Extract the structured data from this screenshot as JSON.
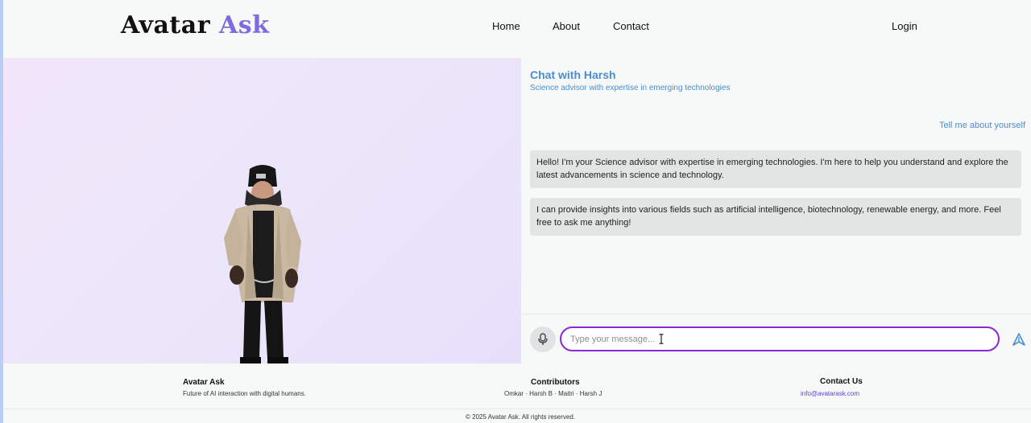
{
  "header": {
    "brand_main": "Avatar",
    "brand_accent": "Ask",
    "nav": [
      "Home",
      "About",
      "Contact"
    ],
    "login": "Login"
  },
  "chat": {
    "title": "Chat with Harsh",
    "subtitle": "Science advisor with expertise in emerging technologies",
    "user_message": "Tell me about yourself",
    "bot_messages": [
      "Hello! I'm your Science advisor with expertise in emerging technologies. I'm here to help you understand and explore the latest advancements in science and technology.",
      "I can provide insights into various fields such as artificial intelligence, biotechnology, renewable energy, and more. Feel free to ask me anything!"
    ],
    "input_placeholder": "Type your message...",
    "input_value": ""
  },
  "footer": {
    "brand_title": "Avatar Ask",
    "brand_tagline": "Future of AI interaction with digital humans.",
    "contributors_title": "Contributors",
    "contributors_list": "Omkar · Harsh B · Maitri · Harsh J",
    "contact_title": "Contact Us",
    "contact_email": "info@avatarask.com",
    "copyright": "© 2025 Avatar Ask. All rights reserved."
  },
  "icons": {
    "mic": "microphone-icon",
    "send": "send-icon",
    "caret": "text-cursor-icon"
  },
  "colors": {
    "accent": "#7b6ddf",
    "chat_blue": "#4a8ed0",
    "input_border": "#8a2ad2"
  }
}
